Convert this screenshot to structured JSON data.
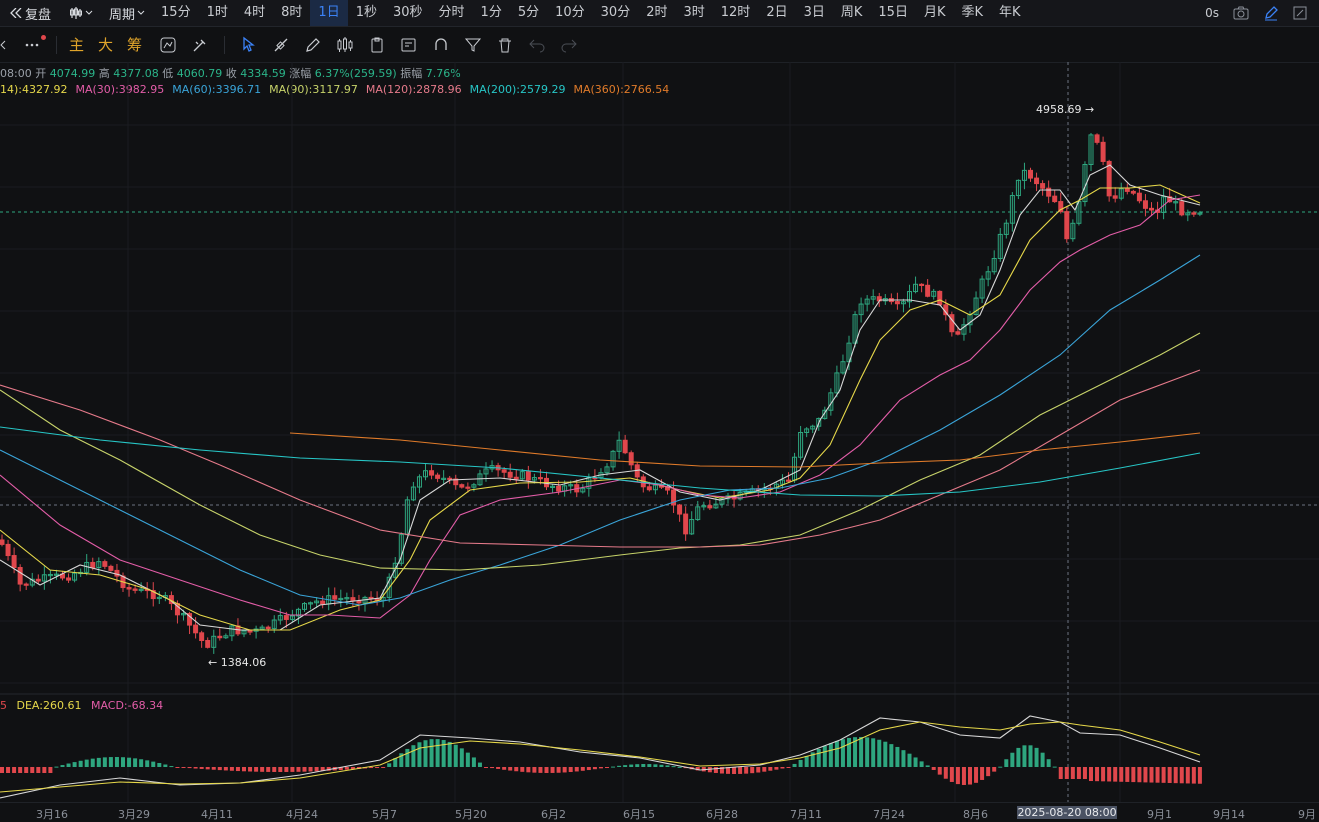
{
  "topbar": {
    "replay_label": "复盘",
    "period_label": "周期",
    "intervals": [
      "15分",
      "1时",
      "4时",
      "8时",
      "1日",
      "1秒",
      "30秒",
      "分时",
      "1分",
      "5分",
      "10分",
      "30分",
      "2时",
      "3时",
      "12时",
      "2日",
      "3日",
      "周K",
      "15日",
      "月K",
      "季K",
      "年K"
    ],
    "active_interval": "1日",
    "latency": "0s"
  },
  "toolbar": {
    "indicators": [
      "主",
      "大",
      "筹"
    ]
  },
  "ohlc": {
    "time": "08:00",
    "open_label": "开",
    "open": "4074.99",
    "high_label": "高",
    "high": "4377.08",
    "low_label": "低",
    "low": "4060.79",
    "close_label": "收",
    "close": "4334.59",
    "change_label": "涨幅",
    "change": "6.37%(259.59)",
    "amp_label": "振幅",
    "amp": "7.76%"
  },
  "ma": [
    {
      "label": "14):4327.92",
      "color": "#e6d84a"
    },
    {
      "label": "MA(30):3982.95",
      "color": "#e35da8"
    },
    {
      "label": "MA(60):3396.71",
      "color": "#3aa4d8"
    },
    {
      "label": "MA(90):3117.97",
      "color": "#c7d36a"
    },
    {
      "label": "MA(120):2878.96",
      "color": "#e57a8a"
    },
    {
      "label": "MA(200):2579.29",
      "color": "#27c6c6"
    },
    {
      "label": "MA(360):2766.54",
      "color": "#e07b2a"
    }
  ],
  "macd": {
    "dif": "5",
    "dea": "DEA:260.61",
    "macd": "MACD:-68.34"
  },
  "annotations": {
    "high_marker": "4958.69",
    "low_marker": "1384.06"
  },
  "x_axis": [
    "3月16",
    "3月29",
    "4月11",
    "4月24",
    "5月7",
    "5月20",
    "6月2",
    "6月15",
    "6月28",
    "7月11",
    "7月24",
    "8月6",
    "9月1",
    "9月14",
    "9月"
  ],
  "crosshair_date": "2025-08-20 08:00",
  "colors": {
    "up": "#2ea67f",
    "down": "#e0474c",
    "bg": "#101113"
  },
  "chart_data": {
    "type": "candlestick",
    "y_axis_shown": false,
    "price_high": 4958.69,
    "price_low": 1384.06,
    "x_range": [
      "2025-03-16",
      "2025-09-14"
    ],
    "ma_last_values": {
      "MA30": 3982.95,
      "MA60": 3396.71,
      "MA90": 3117.97,
      "MA120": 2878.96,
      "MA200": 2579.29,
      "MA360": 2766.54
    }
  }
}
